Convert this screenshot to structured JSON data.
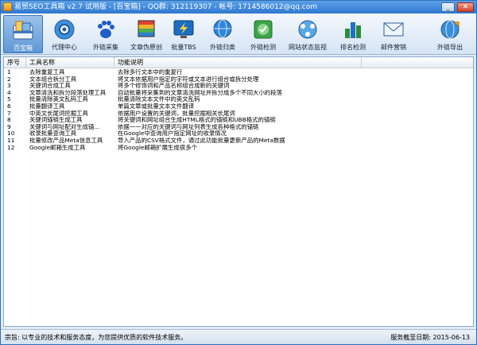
{
  "window": {
    "title": "易贸SEO工具箱 v2.7 试用版 - [百宝箱] - QQ群: 312119307 - 帐号: 1714586012@qq.com"
  },
  "toolbar": {
    "items": [
      {
        "label": "百宝箱",
        "icon": "toolbox-icon",
        "active": true
      },
      {
        "label": "代理中心",
        "icon": "globe-gear-icon"
      },
      {
        "label": "外链采集",
        "icon": "baidu-paw-icon"
      },
      {
        "label": "文章伪原创",
        "icon": "book-stack-icon"
      },
      {
        "label": "批量TBS",
        "icon": "lightning-monitor-icon"
      },
      {
        "label": "外链归类",
        "icon": "globe-sort-icon"
      },
      {
        "label": "外链检测",
        "icon": "map-check-icon"
      },
      {
        "label": "网站状态监视",
        "icon": "network-monitor-icon"
      },
      {
        "label": "排名检测",
        "icon": "bar-chart-icon"
      },
      {
        "label": "邮件营销",
        "icon": "envelope-icon"
      },
      {
        "label": "外链导出",
        "icon": "export-globe-icon"
      }
    ]
  },
  "grid": {
    "columns": [
      "序号",
      "工具名称",
      "功能说明",
      ""
    ],
    "rows": [
      {
        "id": "1",
        "name": "去除重复工具",
        "desc": "去除多行文本中的重复行"
      },
      {
        "id": "2",
        "name": "文本组合拆分工具",
        "desc": "将文本依据用户指定的字符或文本进行组合或拆分处理"
      },
      {
        "id": "3",
        "name": "关键词合成工具",
        "desc": "将多个修饰词和产品名称组合成新的关键词"
      },
      {
        "id": "4",
        "name": "文章清洗和拆分段落处理工具",
        "desc": "自动批量将采集到的文章清洗网址并拆分成多个不同大小的段落"
      },
      {
        "id": "5",
        "name": "批量清除英文乱码工具",
        "desc": "批量清除文本文件中的英文乱码"
      },
      {
        "id": "6",
        "name": "批量翻译工具",
        "desc": "单篇文章或批量文本文件翻译"
      },
      {
        "id": "7",
        "name": "中英文长尾词挖掘工具",
        "desc": "依据用户设置的关键词，批量挖掘相关长尾词"
      },
      {
        "id": "8",
        "name": "关键词锚链生成工具",
        "desc": "将关键词和网址组合生成HTML格式的锚链和UBB格式的锚链"
      },
      {
        "id": "9",
        "name": "关键词与网址配对生成锚...",
        "desc": "依据一一对应的关键词与网址列表生成各种格式的锚链"
      },
      {
        "id": "10",
        "name": "收录批量查询工具",
        "desc": "在Google中查询用户指定网址的收录情况"
      },
      {
        "id": "11",
        "name": "批量修改产品Meta信息工具",
        "desc": "导入产品的CSV格式文件，通过此功能批量更新产品的Meta数据"
      },
      {
        "id": "12",
        "name": "Google邮箱生成工具",
        "desc": "将Google邮箱扩展生成很多个"
      }
    ]
  },
  "status": {
    "left": "宗旨: 以专业的技术和服务态度，为您提供优质的软件技术服务。",
    "right": "服务截至日期: 2015-06-13"
  }
}
